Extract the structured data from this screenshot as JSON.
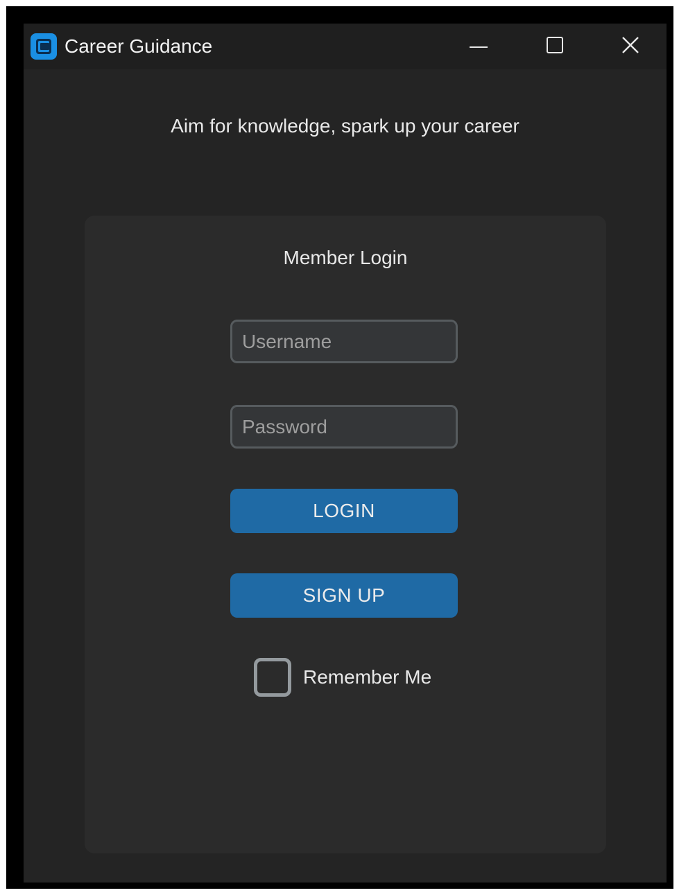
{
  "window": {
    "title": "Career Guidance",
    "icon": "app-logo-icon",
    "controls": {
      "minimize": "minimize-icon",
      "maximize": "maximize-icon",
      "close": "close-icon"
    }
  },
  "header": {
    "tagline": "Aim for knowledge, spark up your career"
  },
  "login_form": {
    "title": "Member Login",
    "username_placeholder": "Username",
    "username_value": "",
    "password_placeholder": "Password",
    "password_value": "",
    "login_label": "LOGIN",
    "signup_label": "SIGN UP",
    "remember_label": "Remember Me",
    "remember_checked": false
  },
  "colors": {
    "window_bg": "#242424",
    "titlebar_bg": "#1f1f1f",
    "card_bg": "#2b2b2b",
    "button_accent": "#1f6aa5",
    "icon_accent": "#1a8fe3",
    "input_bg": "#343638",
    "input_border": "#565b5e",
    "checkbox_border": "#949a9e"
  }
}
